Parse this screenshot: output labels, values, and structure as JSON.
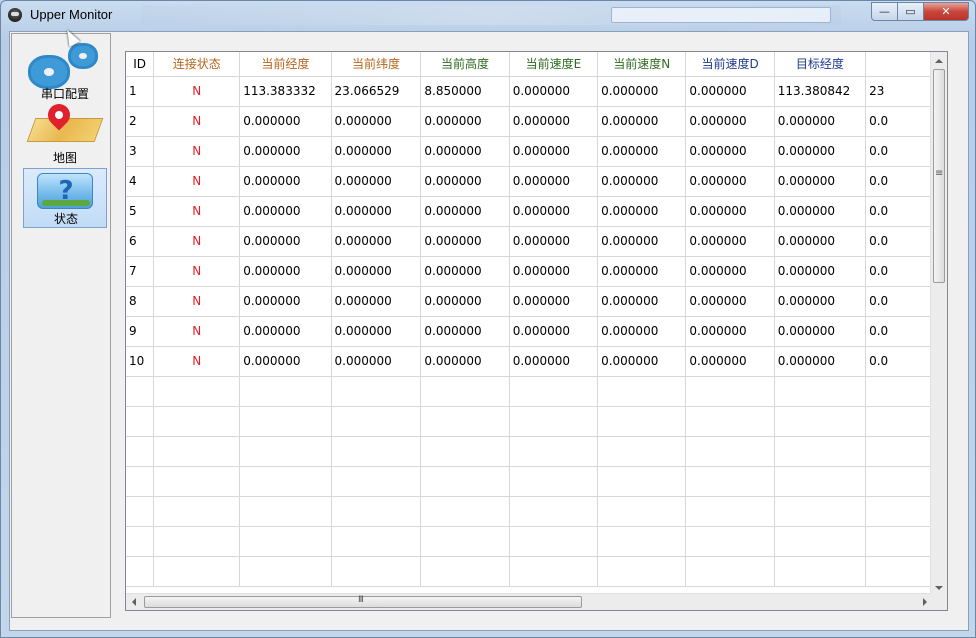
{
  "window": {
    "title": "Upper Monitor",
    "controls": {
      "minimize": "—",
      "maximize": "▭",
      "close": "✕"
    }
  },
  "nav": {
    "items": [
      {
        "id": "serial",
        "label": "串口配置",
        "icon": "gears-icon"
      },
      {
        "id": "map",
        "label": "地图",
        "icon": "map-pin-icon"
      },
      {
        "id": "status",
        "label": "状态",
        "icon": "question-icon",
        "active": true
      }
    ]
  },
  "table": {
    "columns": [
      {
        "label": "ID",
        "color": "#000000"
      },
      {
        "label": "连接状态",
        "color": "#b5651d"
      },
      {
        "label": "当前经度",
        "color": "#b5651d"
      },
      {
        "label": "当前纬度",
        "color": "#b5651d"
      },
      {
        "label": "当前高度",
        "color": "#2e6b1f"
      },
      {
        "label": "当前速度E",
        "color": "#2e6b1f"
      },
      {
        "label": "当前速度N",
        "color": "#2e6b1f"
      },
      {
        "label": "当前速度D",
        "color": "#1f3a8a"
      },
      {
        "label": "目标经度",
        "color": "#1f3a8a"
      },
      {
        "label": "",
        "color": "#1f3a8a"
      }
    ],
    "status_color": "#e0202a",
    "rows": [
      [
        "1",
        "N",
        "113.383332",
        "23.066529",
        "8.850000",
        "0.000000",
        "0.000000",
        "0.000000",
        "113.380842",
        "23"
      ],
      [
        "2",
        "N",
        "0.000000",
        "0.000000",
        "0.000000",
        "0.000000",
        "0.000000",
        "0.000000",
        "0.000000",
        "0.0"
      ],
      [
        "3",
        "N",
        "0.000000",
        "0.000000",
        "0.000000",
        "0.000000",
        "0.000000",
        "0.000000",
        "0.000000",
        "0.0"
      ],
      [
        "4",
        "N",
        "0.000000",
        "0.000000",
        "0.000000",
        "0.000000",
        "0.000000",
        "0.000000",
        "0.000000",
        "0.0"
      ],
      [
        "5",
        "N",
        "0.000000",
        "0.000000",
        "0.000000",
        "0.000000",
        "0.000000",
        "0.000000",
        "0.000000",
        "0.0"
      ],
      [
        "6",
        "N",
        "0.000000",
        "0.000000",
        "0.000000",
        "0.000000",
        "0.000000",
        "0.000000",
        "0.000000",
        "0.0"
      ],
      [
        "7",
        "N",
        "0.000000",
        "0.000000",
        "0.000000",
        "0.000000",
        "0.000000",
        "0.000000",
        "0.000000",
        "0.0"
      ],
      [
        "8",
        "N",
        "0.000000",
        "0.000000",
        "0.000000",
        "0.000000",
        "0.000000",
        "0.000000",
        "0.000000",
        "0.0"
      ],
      [
        "9",
        "N",
        "0.000000",
        "0.000000",
        "0.000000",
        "0.000000",
        "0.000000",
        "0.000000",
        "0.000000",
        "0.0"
      ],
      [
        "10",
        "N",
        "0.000000",
        "0.000000",
        "0.000000",
        "0.000000",
        "0.000000",
        "0.000000",
        "0.000000",
        "0.0"
      ]
    ]
  }
}
